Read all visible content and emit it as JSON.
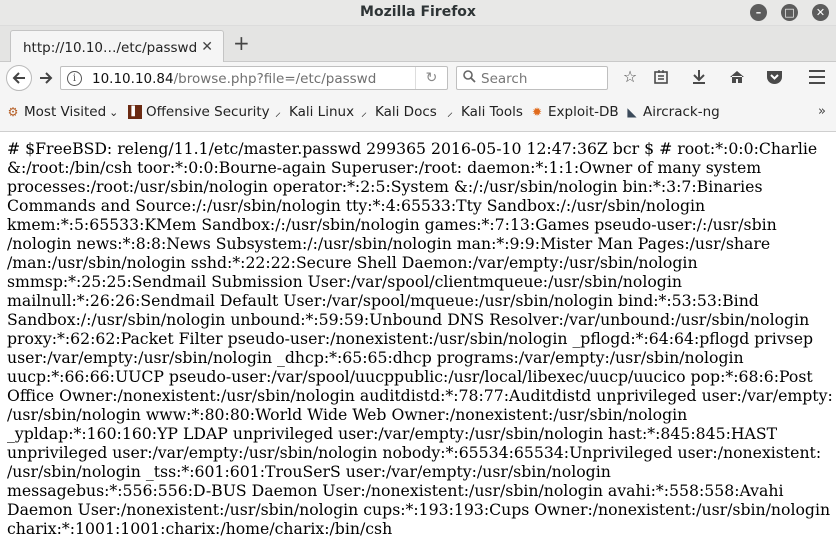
{
  "window": {
    "title": "Mozilla Firefox",
    "controls": [
      "minimize",
      "maximize",
      "close"
    ]
  },
  "tabs": [
    {
      "label": "http://10.10…/etc/passwd",
      "active": true
    }
  ],
  "toolbar": {
    "back_icon": "back-arrow-icon",
    "forward_icon": "forward-arrow-icon",
    "url_host": "10.10.10.84",
    "url_path": "/browse.php?file=/etc/passwd",
    "search_placeholder": "Search"
  },
  "bookmarks": [
    {
      "label": "Most Visited",
      "icon": "gear-icon",
      "has_dropdown": true
    },
    {
      "label": "Offensive Security",
      "icon": "offsec-icon"
    },
    {
      "label": "Kali Linux",
      "icon": "kali-dragon-icon"
    },
    {
      "label": "Kali Docs",
      "icon": "kali-dragon-icon"
    },
    {
      "label": "Kali Tools",
      "icon": "kali-dragon-icon"
    },
    {
      "label": "Exploit-DB",
      "icon": "exploitdb-icon"
    },
    {
      "label": "Aircrack-ng",
      "icon": "aircrack-icon"
    }
  ],
  "page": {
    "lines": [
      "# $FreeBSD: releng/11.1/etc/master.passwd 299365 2016-05-10 12:47:36Z bcr $ # root:*:0:0:Charlie",
      "&:/root:/bin/csh toor:*:0:0:Bourne-again Superuser:/root: daemon:*:1:1:Owner of many system",
      "processes:/root:/usr/sbin/nologin operator:*:2:5:System &:/:/usr/sbin/nologin bin:*:3:7:Binaries",
      "Commands and Source:/:/usr/sbin/nologin tty:*:4:65533:Tty Sandbox:/:/usr/sbin/nologin",
      "kmem:*:5:65533:KMem Sandbox:/:/usr/sbin/nologin games:*:7:13:Games pseudo-user:/:/usr/sbin",
      "/nologin news:*:8:8:News Subsystem:/:/usr/sbin/nologin man:*:9:9:Mister Man Pages:/usr/share",
      "/man:/usr/sbin/nologin sshd:*:22:22:Secure Shell Daemon:/var/empty:/usr/sbin/nologin",
      "smmsp:*:25:25:Sendmail Submission User:/var/spool/clientmqueue:/usr/sbin/nologin",
      "mailnull:*:26:26:Sendmail Default User:/var/spool/mqueue:/usr/sbin/nologin bind:*:53:53:Bind",
      "Sandbox:/:/usr/sbin/nologin unbound:*:59:59:Unbound DNS Resolver:/var/unbound:/usr/sbin/nologin",
      "proxy:*:62:62:Packet Filter pseudo-user:/nonexistent:/usr/sbin/nologin _pflogd:*:64:64:pflogd privsep",
      "user:/var/empty:/usr/sbin/nologin _dhcp:*:65:65:dhcp programs:/var/empty:/usr/sbin/nologin",
      "uucp:*:66:66:UUCP pseudo-user:/var/spool/uucppublic:/usr/local/libexec/uucp/uucico pop:*:68:6:Post",
      "Office Owner:/nonexistent:/usr/sbin/nologin auditdistd:*:78:77:Auditdistd unprivileged user:/var/empty:",
      "/usr/sbin/nologin www:*:80:80:World Wide Web Owner:/nonexistent:/usr/sbin/nologin",
      "_ypldap:*:160:160:YP LDAP unprivileged user:/var/empty:/usr/sbin/nologin hast:*:845:845:HAST",
      "unprivileged user:/var/empty:/usr/sbin/nologin nobody:*:65534:65534:Unprivileged user:/nonexistent:",
      "/usr/sbin/nologin _tss:*:601:601:TrouSerS user:/var/empty:/usr/sbin/nologin",
      "messagebus:*:556:556:D-BUS Daemon User:/nonexistent:/usr/sbin/nologin avahi:*:558:558:Avahi",
      "Daemon User:/nonexistent:/usr/sbin/nologin cups:*:193:193:Cups Owner:/nonexistent:/usr/sbin/nologin",
      "charix:*:1001:1001:charix:/home/charix:/bin/csh"
    ]
  }
}
